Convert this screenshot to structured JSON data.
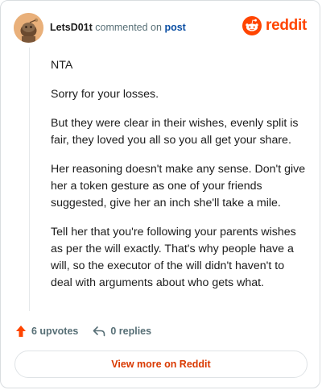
{
  "header": {
    "username": "LetsD01t",
    "action_text": "commented on",
    "post_link": "post",
    "brand": "reddit"
  },
  "comment": {
    "paragraphs": [
      "NTA",
      "Sorry for your losses.",
      "But they were clear in their wishes, evenly split is fair, they loved you all so you all get your share.",
      "Her reasoning doesn't make any sense. Don't give her a token gesture as one of your friends suggested, give her an inch she'll take a mile.",
      "Tell her that you're following your parents wishes as per the will exactly. That's why people have a will, so the executor of the will didn't haven't to deal with arguments about who gets what."
    ]
  },
  "actions": {
    "upvotes": "6 upvotes",
    "replies": "0 replies"
  },
  "footer": {
    "view_more": "View more on Reddit"
  },
  "colors": {
    "brand": "#ff4500",
    "link": "#0a4ea3",
    "muted": "#576f76"
  },
  "icons": [
    "avatar-snoo",
    "reddit-logo-icon",
    "upvote-arrow-icon",
    "reply-arrow-icon"
  ]
}
